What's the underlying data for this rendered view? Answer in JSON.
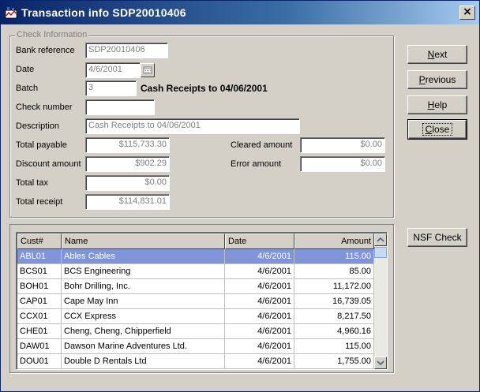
{
  "window": {
    "title": "Transaction info SDP20010406",
    "close_glyph": "×"
  },
  "group": {
    "legend": "Check Information"
  },
  "labels": {
    "bank_reference": "Bank reference",
    "date": "Date",
    "batch": "Batch",
    "check_number": "Check number",
    "description": "Description",
    "total_payable": "Total payable",
    "discount_amount": "Discount amount",
    "total_tax": "Total tax",
    "total_receipt": "Total receipt",
    "cleared_amount": "Cleared amount",
    "error_amount": "Error amount"
  },
  "fields": {
    "bank_reference": "SDP20010406",
    "date": "4/6/2001",
    "batch": "3",
    "batch_description": "Cash Receipts to 04/06/2001",
    "check_number": "",
    "description": "Cash Receipts to 04/06/2001",
    "total_payable": "$115,733.30",
    "discount_amount": "$902.29",
    "total_tax": "$0.00",
    "total_receipt": "$114,831.01",
    "cleared_amount": "$0.00",
    "error_amount": "$0.00"
  },
  "buttons": {
    "next": "Next",
    "previous": "Previous",
    "help": "Help",
    "close": "Close",
    "nsf_check": "NSF Check"
  },
  "grid": {
    "columns": [
      "Cust#",
      "Name",
      "Date",
      "Amount"
    ],
    "rows": [
      {
        "cust": "ABL01",
        "name": "Ables Cables",
        "date": "4/6/2001",
        "amount": "115.00"
      },
      {
        "cust": "BCS01",
        "name": "BCS Engineering",
        "date": "4/6/2001",
        "amount": "85.00"
      },
      {
        "cust": "BOH01",
        "name": "Bohr Drilling, Inc.",
        "date": "4/6/2001",
        "amount": "11,172.00"
      },
      {
        "cust": "CAP01",
        "name": "Cape May Inn",
        "date": "4/6/2001",
        "amount": "16,739.05"
      },
      {
        "cust": "CCX01",
        "name": "CCX Express",
        "date": "4/6/2001",
        "amount": "8,217.50"
      },
      {
        "cust": "CHE01",
        "name": "Cheng, Cheng, Chipperfield",
        "date": "4/6/2001",
        "amount": "4,960.16"
      },
      {
        "cust": "DAW01",
        "name": "Dawson Marine Adventures Ltd.",
        "date": "4/6/2001",
        "amount": "115.00"
      },
      {
        "cust": "DOU01",
        "name": "Double D Rentals Ltd",
        "date": "4/6/2001",
        "amount": "1,755.00"
      }
    ]
  },
  "colors": {
    "title_start": "#0a246a",
    "title_end": "#a6caf0",
    "face": "#d4d0c8",
    "selection": "#7f94d9"
  }
}
